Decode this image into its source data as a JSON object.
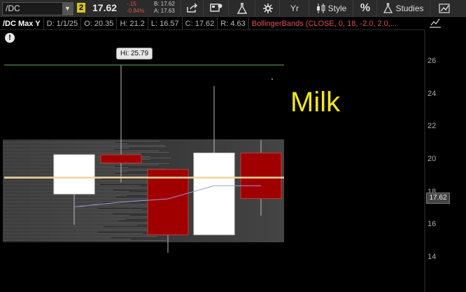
{
  "toolbar": {
    "symbol": "/DC",
    "dropdown_icon": "chevron-down-icon",
    "link_badge": "2",
    "last_price": "17.62",
    "net_change": "-.15",
    "percent_change": "-0.84%",
    "bid": "B: 17.62",
    "ask": "A: 17.63",
    "buttons": {
      "share_icon": "share-icon",
      "message_icon": "message-icon",
      "flask_icon": "flask-icon",
      "settings_icon": "gear-icon",
      "period_label": "Yr",
      "style_label": "Style",
      "percent_label": "%",
      "studies_label": "Studies",
      "drawing_icon": "drawing-icon"
    }
  },
  "info_bar": {
    "title": "/DC Max Y",
    "date": "D: 1/1/25",
    "open": "O: 20.35",
    "high": "H: 21.2",
    "low": "L: 16.57",
    "close": "C: 17.62",
    "range": "R: 4.63",
    "study": "BollingerBands (CLOSE, 0, 18, -2.0, 2.0,..."
  },
  "chart": {
    "hi_label": "Hi: 25.79",
    "watermark": "Milk",
    "current_price_label": "17.62",
    "y_ticks": [
      "26",
      "24",
      "22",
      "20",
      "18",
      "16",
      "14"
    ],
    "colors": {
      "up": "#ffffff",
      "down": "#a00000",
      "bollinger_mid": "#f2d79a",
      "ma_line": "#9a9add",
      "hi_line": "#66b266"
    }
  },
  "chart_data": {
    "type": "candlestick",
    "ylim": [
      13,
      27.5
    ],
    "candles": [
      {
        "open": 17.9,
        "high": 20.3,
        "low": 16.0,
        "close": 20.3
      },
      {
        "open": 20.3,
        "high": 25.79,
        "low": 18.6,
        "close": 19.8
      },
      {
        "open": 19.4,
        "high": 19.4,
        "low": 14.3,
        "close": 15.4
      },
      {
        "open": 15.4,
        "high": 24.5,
        "low": 15.4,
        "close": 20.4
      },
      {
        "open": 20.4,
        "high": 21.2,
        "low": 16.57,
        "close": 17.62
      }
    ],
    "bollinger_mid": 18.9,
    "hi_value": 25.79,
    "ma_line": [
      17.1,
      17.4,
      17.6,
      18.4,
      18.4
    ]
  }
}
